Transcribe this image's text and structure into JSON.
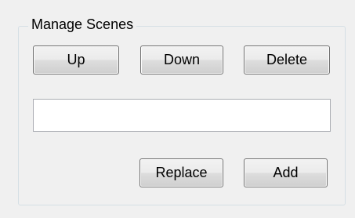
{
  "group": {
    "title": "Manage Scenes"
  },
  "buttons": {
    "up": "Up",
    "down": "Down",
    "delete": "Delete",
    "replace": "Replace",
    "add": "Add"
  },
  "scene_input": {
    "value": "",
    "placeholder": ""
  }
}
